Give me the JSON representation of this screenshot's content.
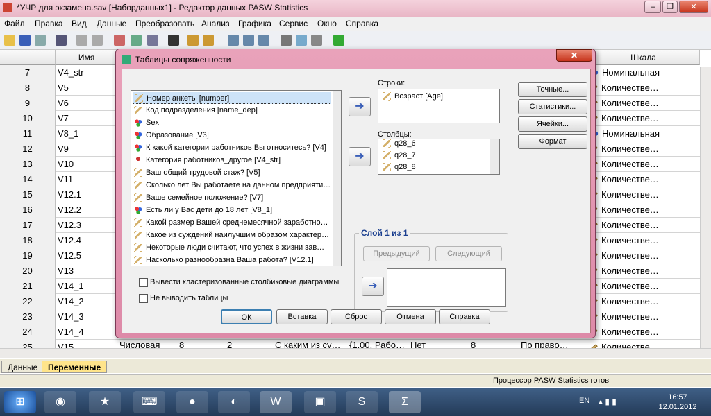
{
  "window": {
    "title": "*УЧР для экзамена.sav [Наборданных1] - Редактор данных PASW Statistics"
  },
  "menu": [
    "Файл",
    "Правка",
    "Вид",
    "Данные",
    "Преобразовать",
    "Анализ",
    "Графика",
    "Сервис",
    "Окно",
    "Справка"
  ],
  "grid": {
    "headers": {
      "name": "Имя",
      "scale": "Шкала"
    },
    "rows": [
      {
        "num": "7",
        "name": "V4_str",
        "scale": "Номинальная",
        "scale_icon": "nominal-icon"
      },
      {
        "num": "8",
        "name": "V5",
        "scale": "Количестве…",
        "scale_icon": "scale-icon"
      },
      {
        "num": "9",
        "name": "V6",
        "scale": "Количестве…",
        "scale_icon": "scale-icon"
      },
      {
        "num": "10",
        "name": "V7",
        "scale": "Количестве…",
        "scale_icon": "scale-icon"
      },
      {
        "num": "11",
        "name": "V8_1",
        "scale": "Номинальная",
        "scale_icon": "nominal-icon"
      },
      {
        "num": "12",
        "name": "V9",
        "scale": "Количестве…",
        "scale_icon": "scale-icon"
      },
      {
        "num": "13",
        "name": "V10",
        "scale": "Количестве…",
        "scale_icon": "scale-icon"
      },
      {
        "num": "14",
        "name": "V11",
        "scale": "Количестве…",
        "scale_icon": "scale-icon"
      },
      {
        "num": "15",
        "name": "V12.1",
        "scale": "Количестве…",
        "scale_icon": "scale-icon"
      },
      {
        "num": "16",
        "name": "V12.2",
        "scale": "Количестве…",
        "scale_icon": "scale-icon"
      },
      {
        "num": "17",
        "name": "V12.3",
        "scale": "Количестве…",
        "scale_icon": "scale-icon"
      },
      {
        "num": "18",
        "name": "V12.4",
        "scale": "Количестве…",
        "scale_icon": "scale-icon"
      },
      {
        "num": "19",
        "name": "V12.5",
        "scale": "Количестве…",
        "scale_icon": "scale-icon"
      },
      {
        "num": "20",
        "name": "V13",
        "scale": "Количестве…",
        "scale_icon": "scale-icon"
      },
      {
        "num": "21",
        "name": "V14_1",
        "scale": "Количестве…",
        "scale_icon": "scale-icon"
      },
      {
        "num": "22",
        "name": "V14_2",
        "scale": "Количестве…",
        "scale_icon": "scale-icon"
      },
      {
        "num": "23",
        "name": "V14_3",
        "scale": "Количестве…",
        "scale_icon": "scale-icon"
      },
      {
        "num": "24",
        "name": "V14_4",
        "scale": "Количестве…",
        "scale_icon": "scale-icon"
      },
      {
        "num": "25",
        "name": "V15",
        "scale": "Количестве…",
        "scale_icon": "scale-icon"
      }
    ],
    "row25_extra": {
      "type": "Числовая",
      "width": "8",
      "decimals": "2",
      "label": "С каким из су…",
      "values": "{1,00, Рабо…",
      "missing": "Нет",
      "columns": "8",
      "align": "По право…"
    }
  },
  "tabs": {
    "data": "Данные",
    "variables": "Переменные"
  },
  "status": "Процессор PASW Statistics  готов",
  "dialog": {
    "title": "Таблицы сопряженности",
    "variables": [
      {
        "label": "Номер анкеты [number]",
        "icon": "scale-icon",
        "selected": true
      },
      {
        "label": "Код подразделения [name_dep]",
        "icon": "scale-icon"
      },
      {
        "label": "Sex",
        "icon": "nominal-icon"
      },
      {
        "label": "Образование [V3]",
        "icon": "nominal-icon"
      },
      {
        "label": "К какой категории работников Вы относитесь? [V4]",
        "icon": "nominal-icon"
      },
      {
        "label": "Категория работников_другое [V4_str]",
        "icon": "string-icon"
      },
      {
        "label": "Ваш общий трудовой стаж? [V5]",
        "icon": "scale-icon"
      },
      {
        "label": "Сколько лет Вы работаете на данном предприяти…",
        "icon": "scale-icon"
      },
      {
        "label": "Ваше семейное положение? [V7]",
        "icon": "scale-icon"
      },
      {
        "label": "Есть ли у Вас дети до 18 лет [V8_1]",
        "icon": "nominal-icon"
      },
      {
        "label": "Какой размер Вашей среднемесячной заработно…",
        "icon": "scale-icon"
      },
      {
        "label": "Какое из суждений наилучшим образом характер…",
        "icon": "scale-icon"
      },
      {
        "label": "Некоторые люди считают, что успех в жизни зав…",
        "icon": "scale-icon"
      },
      {
        "label": "Насколько разнообразна Ваша работа? [V12.1]",
        "icon": "scale-icon"
      }
    ],
    "rows_label": "Строки:",
    "rows_items": [
      "Возраст [Age]"
    ],
    "cols_label": "Столбцы:",
    "cols_items": [
      "q28_6",
      "q28_7",
      "q28_8"
    ],
    "layer_title": "Слой 1 из 1",
    "prev_button": "Предыдущий",
    "next_button": "Следующий",
    "right_buttons": [
      "Точные...",
      "Статистики...",
      "Ячейки...",
      "Формат"
    ],
    "check_clustered": "Вывести кластеризованные столбиковые диаграммы",
    "check_no_tables": "Не выводить таблицы",
    "footer_buttons": [
      "ОК",
      "Вставка",
      "Сброс",
      "Отмена",
      "Справка"
    ]
  },
  "taskbar": {
    "lang": "EN",
    "time": "16:57",
    "date": "12.01.2012"
  }
}
